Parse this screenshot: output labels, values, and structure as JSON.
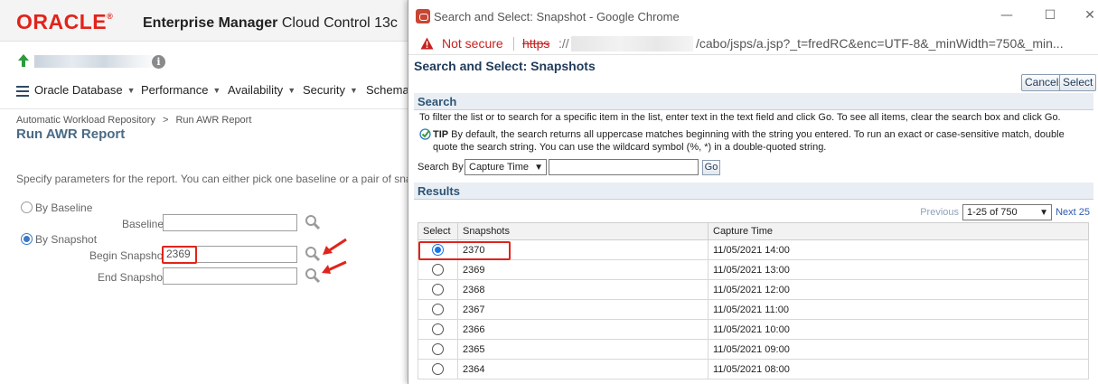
{
  "em": {
    "logo": "ORACLE",
    "product_bold": "Enterprise Manager",
    "product_rest": " Cloud Control 13c",
    "menu": [
      {
        "label": "Oracle Database"
      },
      {
        "label": "Performance"
      },
      {
        "label": "Availability"
      },
      {
        "label": "Security"
      },
      {
        "label": "Schema"
      }
    ],
    "breadcrumb": {
      "link": "Automatic Workload Repository",
      "sep": ">",
      "current": "Run AWR Report"
    },
    "page_title": "Run AWR Report",
    "instructions": "Specify parameters for the report. You can either pick one baseline or a pair of snapshots",
    "by_baseline_label": "By Baseline",
    "baseline_label": "Baseline",
    "baseline_value": "",
    "by_snapshot_label": "By Snapshot",
    "begin_snapshot_label": "Begin Snapshot",
    "begin_snapshot_value": "2369",
    "end_snapshot_label": "End Snapshot",
    "end_snapshot_value": "",
    "selected_mode": "By Snapshot"
  },
  "popup": {
    "window_title": "Search and Select: Snapshot - Google Chrome",
    "not_secure": "Not secure",
    "url_scheme": "https",
    "url_slashes": "://",
    "url_path": "/cabo/jsps/a.jsp?_t=fredRC&enc=UTF-8&_minWidth=750&_min...",
    "title": "Search and Select: Snapshots",
    "cancel_label": "Cancel",
    "select_label": "Select",
    "search_heading": "Search",
    "search_desc": "To filter the list or to search for a specific item in the list, enter text in the text field and click Go. To see all items, clear the search box and click Go.",
    "tip_label": "TIP",
    "tip_text": " By default, the search returns all uppercase matches beginning with the string you entered. To run an exact or case-sensitive match, double quote the search string. You can use the wildcard symbol (%, *) in a double-quoted string.",
    "search_by_label": "Search By",
    "search_by_value": "Capture Time",
    "search_input_value": "",
    "go_label": "Go",
    "results_heading": "Results",
    "previous_label": "Previous",
    "range_value": "1-25 of 750",
    "next_label": "Next 25",
    "columns": [
      "Select",
      "Snapshots",
      "Capture Time"
    ],
    "rows": [
      {
        "snapshot": "2370",
        "capture_time": "11/05/2021 14:00",
        "selected": true
      },
      {
        "snapshot": "2369",
        "capture_time": "11/05/2021 13:00",
        "selected": false
      },
      {
        "snapshot": "2368",
        "capture_time": "11/05/2021 12:00",
        "selected": false
      },
      {
        "snapshot": "2367",
        "capture_time": "11/05/2021 11:00",
        "selected": false
      },
      {
        "snapshot": "2366",
        "capture_time": "11/05/2021 10:00",
        "selected": false
      },
      {
        "snapshot": "2365",
        "capture_time": "11/05/2021 09:00",
        "selected": false
      },
      {
        "snapshot": "2364",
        "capture_time": "11/05/2021 08:00",
        "selected": false
      }
    ]
  },
  "colors": {
    "oracle_red": "#e2231a",
    "annotation_red": "#e0241b",
    "title_blue": "#4a6b86",
    "link_blue": "#2a5db0",
    "radio_blue": "#1a73e8"
  }
}
